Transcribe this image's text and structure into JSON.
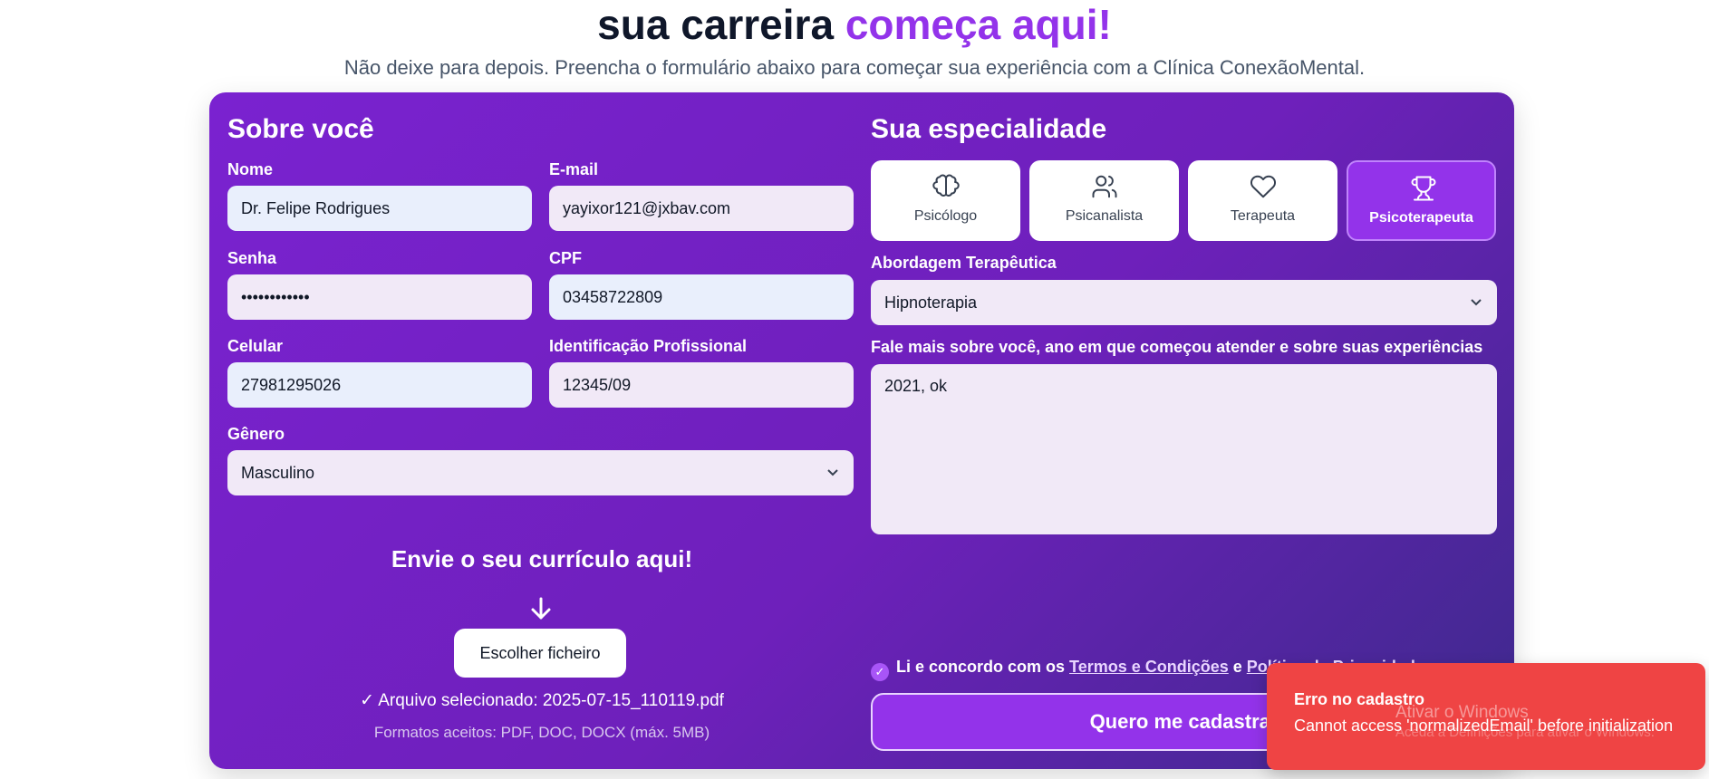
{
  "hero": {
    "title_main": "sua carreira ",
    "title_accent": "começa aqui!",
    "subtitle": "Não deixe para depois. Preencha o formulário abaixo para começar sua experiência com a Clínica ConexãoMental."
  },
  "about": {
    "title": "Sobre você",
    "name_label": "Nome",
    "name_value": "Dr. Felipe Rodrigues",
    "email_label": "E-mail",
    "email_value": "yayixor121@jxbav.com",
    "password_label": "Senha",
    "password_value": "••••••••••••",
    "cpf_label": "CPF",
    "cpf_value": "03458722809",
    "phone_label": "Celular",
    "phone_value": "27981295026",
    "id_label": "Identificação Profissional",
    "id_value": "12345/09",
    "gender_label": "Gênero",
    "gender_value": "Masculino"
  },
  "specialty": {
    "title": "Sua especialidade",
    "options": [
      {
        "label": "Psicólogo",
        "icon": "brain-icon",
        "selected": false
      },
      {
        "label": "Psicanalista",
        "icon": "users-icon",
        "selected": false
      },
      {
        "label": "Terapeuta",
        "icon": "heart-icon",
        "selected": false
      },
      {
        "label": "Psicoterapeuta",
        "icon": "trophy-icon",
        "selected": true
      }
    ],
    "approach_label": "Abordagem Terapêutica",
    "approach_value": "Hipnoterapia",
    "about_label": "Fale mais sobre você, ano em que começou atender e sobre suas experiências",
    "about_value": "2021, ok"
  },
  "upload": {
    "title": "Envie o seu currículo aqui!",
    "button": "Escolher ficheiro",
    "selected": "✓ Arquivo selecionado: 2025-07-15_110119.pdf",
    "formats": "Formatos aceitos: PDF, DOC, DOCX (máx. 5MB)"
  },
  "terms": {
    "prefix": "Li e concordo com os ",
    "terms_link": "Termos e Condições",
    "and": " e ",
    "privacy_link": "Política de Privacidade"
  },
  "submit": {
    "label": "Quero me cadastrar"
  },
  "toast": {
    "title": "Erro no cadastro",
    "message": "Cannot access 'normalizedEmail' before initialization"
  },
  "watermark": {
    "title": "Ativar o Windows",
    "subtitle": "Aceda a Definições para ativar o Windows."
  },
  "colors": {
    "accent": "#9333ea",
    "card_gradient_start": "#7a22d0",
    "card_gradient_end": "#3d2a8c",
    "error": "#ef4444"
  }
}
